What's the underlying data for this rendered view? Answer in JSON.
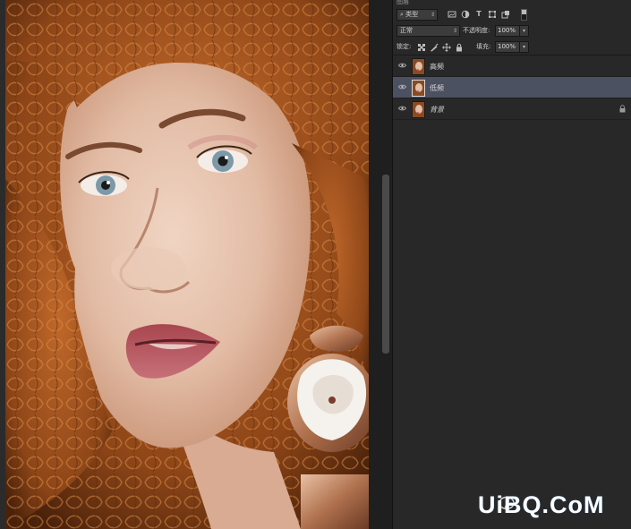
{
  "panel": {
    "tab_label": "图层",
    "filter": {
      "value": "类型",
      "icon": "search-icon"
    },
    "filter_icons": [
      "image-filter-icon",
      "adjustment-filter-icon",
      "type-filter-icon",
      "shape-filter-icon",
      "smart-object-filter-icon"
    ],
    "blend": {
      "mode": "正常",
      "opacity_label": "不透明度:",
      "opacity_value": "100%"
    },
    "lock": {
      "label": "锁定:",
      "fill_label": "填充:",
      "fill_value": "100%"
    },
    "layers": [
      {
        "name": "高频",
        "visible": true,
        "selected": false,
        "locked": false
      },
      {
        "name": "低频",
        "visible": true,
        "selected": true,
        "locked": false
      },
      {
        "name": "背景",
        "visible": true,
        "selected": false,
        "locked": true
      }
    ]
  },
  "colors": {
    "panel_bg": "#282828",
    "selected_layer": "#4c5161",
    "hair": "#a5571f",
    "skin": "#e2bfa8",
    "lips": "#b5565f",
    "watermark_blue": "#1b5aa6"
  }
}
